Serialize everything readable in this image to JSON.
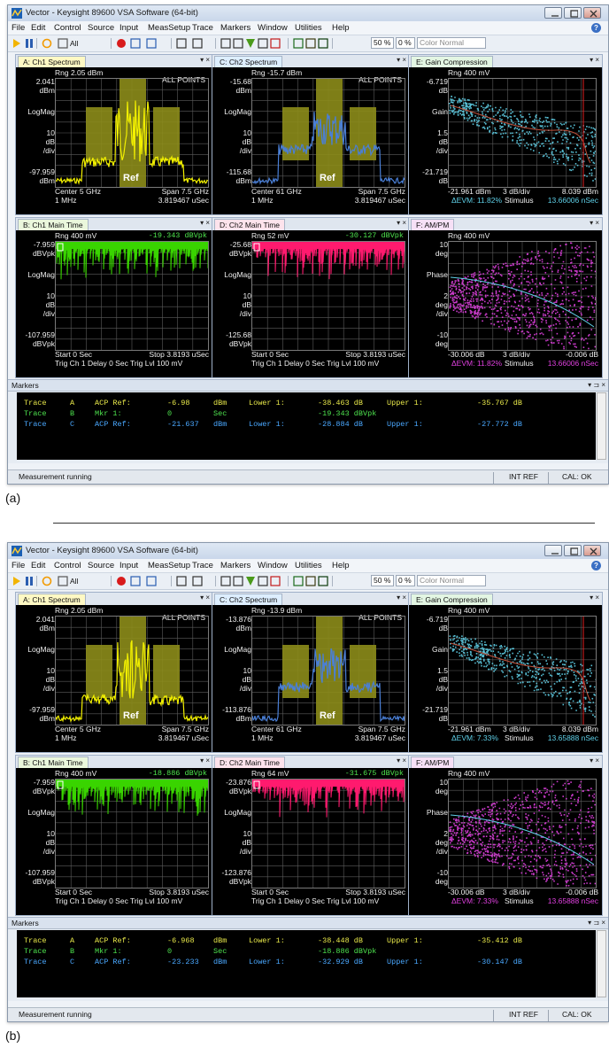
{
  "colors": {
    "yellow_trace": "#f2f000",
    "blue_trace": "#4a7fd6",
    "green_trace": "#39d400",
    "red_trace": "#ff1a6e",
    "cyan_scatter": "#5fd0e8",
    "magenta_scatter": "#e040e0",
    "ref_box": "#8c8c1a",
    "marker_yellow": "#e8e84a",
    "marker_green": "#4ee44e",
    "marker_cyan": "#4aa8ff"
  },
  "titlebar": {
    "title": "Vector - Keysight 89600 VSA Software (64-bit)"
  },
  "menu": [
    "File",
    "Edit",
    "Control",
    "Source",
    "Input",
    "MeasSetup",
    "Trace",
    "Markers",
    "Window",
    "Utilities",
    "Help"
  ],
  "toolbar": {
    "all": "All",
    "zoom": "50 %",
    "persist": "0 %",
    "color": "Color Normal"
  },
  "shots": [
    {
      "caption": "(a)",
      "panels": {
        "a": {
          "tab": "A: Ch1 Spectrum",
          "rng": "Rng 2.05 dBm",
          "top": "2.041",
          "top_unit": "dBm",
          "mode": "LogMag",
          "scale": "10",
          "scale_u1": "dB",
          "scale_u2": "/div",
          "bottom": "-97.959",
          "bottom_unit": "dBm",
          "allpoints": "ALL POINTS",
          "ref": "Ref",
          "center": "Center 5 GHz",
          "span": "Span 7.5 GHz",
          "rbw": "1 MHz",
          "time": "3.819467 uSec"
        },
        "c": {
          "tab": "C: Ch2 Spectrum",
          "rng": "Rng -15.7 dBm",
          "top": "-15.68",
          "top_unit": "dBm",
          "mode": "LogMag",
          "scale": "10",
          "scale_u1": "dB",
          "scale_u2": "/div",
          "bottom": "-115.68",
          "bottom_unit": "dBm",
          "allpoints": "ALL POINTS",
          "ref": "Ref",
          "center": "Center 61 GHz",
          "span": "Span 7.5 GHz",
          "rbw": "1 MHz",
          "time": "3.819467 uSec"
        },
        "e": {
          "tab": "E: Gain Compression",
          "rng": "Rng 400 mV",
          "top": "-6.719",
          "top_unit": "dB",
          "mode": "Gain",
          "scale": "1.5",
          "scale_u1": "dB",
          "scale_u2": "/div",
          "bottom": "-21.719",
          "bottom_unit": "dB",
          "xleft": "-21.961 dBm",
          "xmid": "3 dB/div",
          "xright": "8.039 dBm",
          "evm": "ΔEVM: 11.82%",
          "stim_lbl": "Stimulus",
          "stim": "13.66006 nSec"
        },
        "b": {
          "tab": "B: Ch1 Main Time",
          "rng": "Rng 400 mV",
          "mkr": "-19.343 dBVpk",
          "top": "-7.959",
          "top_unit": "dBVpk",
          "mode": "LogMag",
          "scale": "10",
          "scale_u1": "dB",
          "scale_u2": "/div",
          "bottom": "-107.959",
          "bottom_unit": "dBVpk",
          "start": "Start 0  Sec",
          "stop": "Stop 3.8193 uSec",
          "trig": "Trig Ch 1   Delay 0  Sec   Trig Lvl 100 mV"
        },
        "d": {
          "tab": "D: Ch2 Main Time",
          "rng": "Rng 52 mV",
          "mkr": "-30.127 dBVpk",
          "top": "-25.68",
          "top_unit": "dBVpk",
          "mode": "LogMag",
          "scale": "10",
          "scale_u1": "dB",
          "scale_u2": "/div",
          "bottom": "-125.68",
          "bottom_unit": "dBVpk",
          "start": "Start 0  Sec",
          "stop": "Stop 3.8193 uSec",
          "trig": "Trig Ch 1   Delay 0  Sec   Trig Lvl 100 mV"
        },
        "f": {
          "tab": "F: AM/PM",
          "rng": "Rng 400 mV",
          "top": "10",
          "top_unit": "deg",
          "mode": "Phase",
          "scale": "2",
          "scale_u1": "deg",
          "scale_u2": "/div",
          "bottom": "-10",
          "bottom_unit": "deg",
          "xleft": "-30.006 dB",
          "xmid": "3 dB/div",
          "xright": "-0.006 dB",
          "evm": "ΔEVM: 11.82%",
          "stim_lbl": "Stimulus",
          "stim": "13.66006 nSec"
        }
      },
      "markers": {
        "title": "Markers",
        "rows": [
          [
            "Trace",
            "A",
            "ACP Ref:",
            "-6.98",
            "dBm",
            "Lower 1:",
            "-38.463 dB",
            "Upper 1:",
            "-35.767 dB"
          ],
          [
            "Trace",
            "B",
            "Mkr   1:",
            "0",
            "Sec",
            "",
            "-19.343 dBVpk",
            "",
            ""
          ],
          [
            "Trace",
            "C",
            "ACP Ref:",
            "-21.637",
            "dBm",
            "Lower 1:",
            "-28.884 dB",
            "Upper 1:",
            "-27.772 dB"
          ]
        ]
      },
      "status": {
        "left": "Measurement running",
        "ref": "INT REF",
        "cal": "CAL: OK"
      }
    },
    {
      "caption": "(b)",
      "panels": {
        "a": {
          "tab": "A: Ch1 Spectrum",
          "rng": "Rng 2.05 dBm",
          "top": "2.041",
          "top_unit": "dBm",
          "mode": "LogMag",
          "scale": "10",
          "scale_u1": "dB",
          "scale_u2": "/div",
          "bottom": "-97.959",
          "bottom_unit": "dBm",
          "allpoints": "ALL POINTS",
          "ref": "Ref",
          "center": "Center 5 GHz",
          "span": "Span 7.5 GHz",
          "rbw": "1 MHz",
          "time": "3.819467 uSec"
        },
        "c": {
          "tab": "C: Ch2 Spectrum",
          "rng": "Rng -13.9 dBm",
          "top": "-13.876",
          "top_unit": "dBm",
          "mode": "LogMag",
          "scale": "10",
          "scale_u1": "dB",
          "scale_u2": "/div",
          "bottom": "-113.876",
          "bottom_unit": "dBm",
          "allpoints": "ALL POINTS",
          "ref": "Ref",
          "center": "Center 61 GHz",
          "span": "Span 7.5 GHz",
          "rbw": "1 MHz",
          "time": "3.819467 uSec"
        },
        "e": {
          "tab": "E: Gain Compression",
          "rng": "Rng 400 mV",
          "top": "-6.719",
          "top_unit": "dB",
          "mode": "Gain",
          "scale": "1.5",
          "scale_u1": "dB",
          "scale_u2": "/div",
          "bottom": "-21.719",
          "bottom_unit": "dB",
          "xleft": "-21.961 dBm",
          "xmid": "3 dB/div",
          "xright": "8.039 dBm",
          "evm": "ΔEVM: 7.33%",
          "stim_lbl": "Stimulus",
          "stim": "13.65888 nSec"
        },
        "b": {
          "tab": "B: Ch1 Main Time",
          "rng": "Rng 400 mV",
          "mkr": "-18.886 dBVpk",
          "top": "-7.959",
          "top_unit": "dBVpk",
          "mode": "LogMag",
          "scale": "10",
          "scale_u1": "dB",
          "scale_u2": "/div",
          "bottom": "-107.959",
          "bottom_unit": "dBVpk",
          "start": "Start 0  Sec",
          "stop": "Stop 3.8193 uSec",
          "trig": "Trig Ch 1   Delay 0  Sec   Trig Lvl 100 mV"
        },
        "d": {
          "tab": "D: Ch2 Main Time",
          "rng": "Rng 64 mV",
          "mkr": "-31.675 dBVpk",
          "top": "-23.876",
          "top_unit": "dBVpk",
          "mode": "LogMag",
          "scale": "10",
          "scale_u1": "dB",
          "scale_u2": "/div",
          "bottom": "-123.876",
          "bottom_unit": "dBVpk",
          "start": "Start 0  Sec",
          "stop": "Stop 3.8193 uSec",
          "trig": "Trig Ch 1   Delay 0  Sec   Trig Lvl 100 mV"
        },
        "f": {
          "tab": "F: AM/PM",
          "rng": "Rng 400 mV",
          "top": "10",
          "top_unit": "deg",
          "mode": "Phase",
          "scale": "2",
          "scale_u1": "deg",
          "scale_u2": "/div",
          "bottom": "-10",
          "bottom_unit": "deg",
          "xleft": "-30.006 dB",
          "xmid": "3 dB/div",
          "xright": "-0.006 dB",
          "evm": "ΔEVM: 7.33%",
          "stim_lbl": "Stimulus",
          "stim": "13.65888 nSec"
        }
      },
      "markers": {
        "title": "Markers",
        "rows": [
          [
            "Trace",
            "A",
            "ACP Ref:",
            "-6.968",
            "dBm",
            "Lower 1:",
            "-38.448 dB",
            "Upper 1:",
            "-35.412 dB"
          ],
          [
            "Trace",
            "B",
            "Mkr   1:",
            "0",
            "Sec",
            "",
            "-18.886 dBVpk",
            "",
            ""
          ],
          [
            "Trace",
            "C",
            "ACP Ref:",
            "-23.233",
            "dBm",
            "Lower 1:",
            "-32.929 dB",
            "Upper 1:",
            "-30.147 dB"
          ]
        ]
      },
      "status": {
        "left": "Measurement running",
        "ref": "INT REF",
        "cal": "CAL: OK"
      }
    }
  ]
}
